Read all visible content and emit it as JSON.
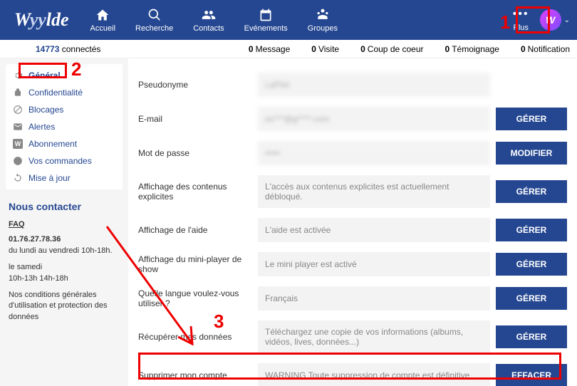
{
  "brand": {
    "part1": "W",
    "part2": "yy",
    "part3": "lde"
  },
  "nav": {
    "home": "Accueil",
    "search": "Recherche",
    "contacts": "Contacts",
    "events": "Evénements",
    "groups": "Groupes",
    "more": "Plus"
  },
  "avatar_letter": "W",
  "status": {
    "connected_count": "14773",
    "connected_label": "connectés",
    "items": [
      {
        "n": "0",
        "label": "Message"
      },
      {
        "n": "0",
        "label": "Visite"
      },
      {
        "n": "0",
        "label": "Coup de coeur"
      },
      {
        "n": "0",
        "label": "Témoignage"
      },
      {
        "n": "0",
        "label": "Notification"
      }
    ]
  },
  "sidebar": {
    "items": [
      "Général",
      "Confidentialité",
      "Blocages",
      "Alertes",
      "Abonnement",
      "Vos commandes",
      "Mise à jour"
    ]
  },
  "contact": {
    "title": "Nous contacter",
    "faq": "FAQ",
    "phone": "01.76.27.78.36",
    "weekdays": "du lundi au vendredi 10h-18h.",
    "saturday_label": "le samedi",
    "saturday_hours": "10h-13h 14h-18h",
    "terms": "Nos conditions générales d'utilisation et protection des données"
  },
  "form": {
    "pseudo": {
      "label": "Pseudonyme",
      "value": "LaPiet"
    },
    "email": {
      "label": "E-mail",
      "value": "ex***@g****.com",
      "btn": "GÉRER"
    },
    "password": {
      "label": "Mot de passe",
      "value": "•••••",
      "btn": "MODIFIER"
    },
    "explicit": {
      "label": "Affichage des contenus explicites",
      "value": "L'accès aux contenus explicites est actuellement débloqué.",
      "btn": "GÉRER"
    },
    "help": {
      "label": "Affichage de l'aide",
      "value": "L'aide est activée",
      "btn": "GÉRER"
    },
    "miniplayer": {
      "label": "Affichage du mini-player de show",
      "value": "Le mini player est activé",
      "btn": "GÉRER"
    },
    "language": {
      "label": "Quelle langue voulez-vous utiliser ?",
      "value": "Français",
      "btn": "GÉRER"
    },
    "recover": {
      "label": "Récupérer mes données",
      "value": "Téléchargez une copie de vos informations (albums, vidéos, lives, données...)",
      "btn": "GÉRER"
    },
    "delete": {
      "label": "Supprimer mon compte",
      "value": "WARNING Toute suppression de compte est définitive",
      "btn": "EFFACER"
    }
  },
  "annotations": {
    "n1": "1",
    "n2": "2",
    "n3": "3"
  }
}
